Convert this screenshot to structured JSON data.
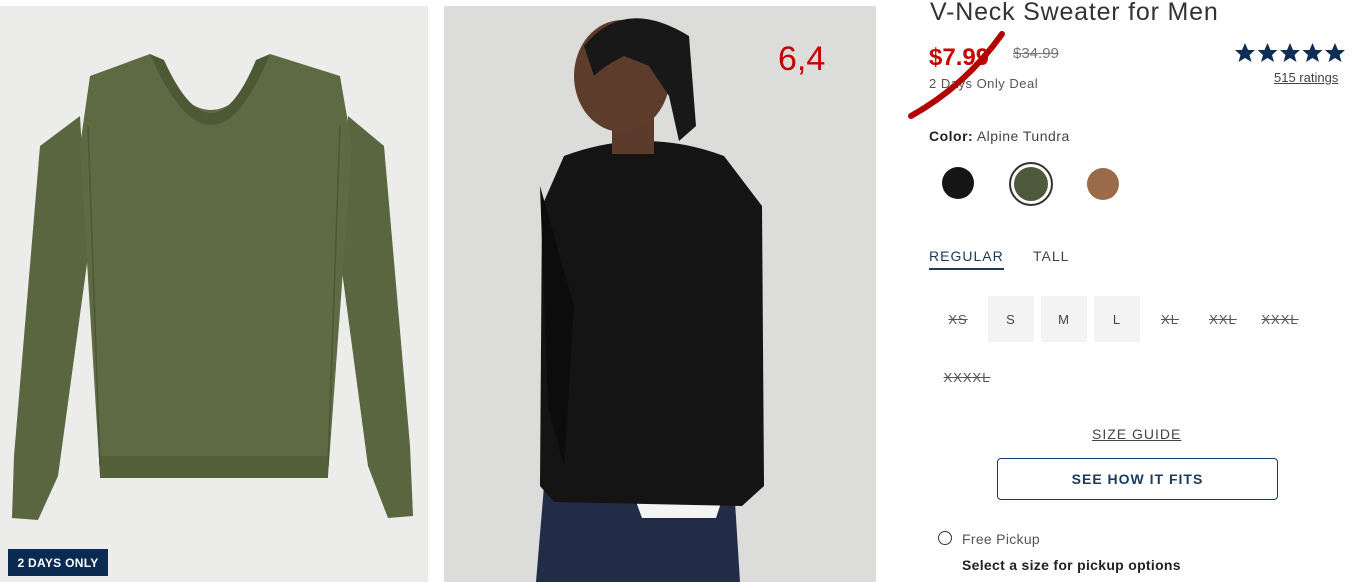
{
  "gallery": {
    "badge": "2 DAYS ONLY",
    "annotation": "6,4"
  },
  "product": {
    "title": "V-Neck Sweater for Men",
    "sale_price": "$7.99",
    "original_price": "$34.99",
    "deal_text": "2 Days Only Deal",
    "rating_value": 4.7,
    "ratings_link": "515 ratings",
    "accent_color": "#c00000"
  },
  "color": {
    "label": "Color:",
    "selected": "Alpine Tundra",
    "swatches": [
      "#151515",
      "#4f5a3c",
      "#9b6a48"
    ]
  },
  "fit_tabs": [
    "REGULAR",
    "TALL"
  ],
  "sizes": [
    {
      "label": "XS",
      "available": false
    },
    {
      "label": "S",
      "available": true
    },
    {
      "label": "M",
      "available": true
    },
    {
      "label": "L",
      "available": true
    },
    {
      "label": "XL",
      "available": false
    },
    {
      "label": "XXL",
      "available": false
    },
    {
      "label": "XXXL",
      "available": false
    },
    {
      "label": "XXXXL",
      "available": false
    }
  ],
  "size_guide": "SIZE GUIDE",
  "fit_button": "SEE HOW IT FITS",
  "pickup": {
    "label": "Free Pickup",
    "sub": "Select a size for pickup options"
  }
}
